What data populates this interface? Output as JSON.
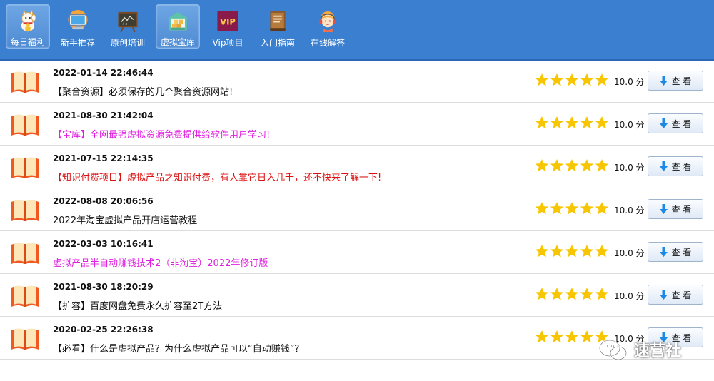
{
  "nav": {
    "items": [
      {
        "label": "每日福利",
        "icon": "lucky-cat-icon",
        "active": true
      },
      {
        "label": "新手推荐",
        "icon": "monitor-icon",
        "active": false
      },
      {
        "label": "原创培训",
        "icon": "chalkboard-icon",
        "active": false
      },
      {
        "label": "虚拟宝库",
        "icon": "warehouse-icon",
        "active": true
      },
      {
        "label": "Vip项目",
        "icon": "vip-icon",
        "active": false
      },
      {
        "label": "入门指南",
        "icon": "book-icon",
        "active": false
      },
      {
        "label": "在线解答",
        "icon": "support-agent-icon",
        "active": false
      }
    ],
    "vip_text": "VIP"
  },
  "colors": {
    "topbar": "#3a7fd0",
    "magenta": "#e020e0",
    "red": "#dd1111",
    "star": "#f7c600"
  },
  "rows": [
    {
      "date": "2022-01-14 22:46:44",
      "title": "【聚合资源】必须保存的几个聚合资源网站!",
      "color": "black",
      "stars": 5,
      "score": "10.0 分",
      "button": "查 看"
    },
    {
      "date": "2021-08-30 21:42:04",
      "title": "【宝库】全网最强虚拟资源免费提供给软件用户学习!",
      "color": "magenta",
      "stars": 5,
      "score": "10.0 分",
      "button": "查 看"
    },
    {
      "date": "2021-07-15 22:14:35",
      "title": "【知识付费项目】虚拟产品之知识付费，有人靠它日入几千，还不快来了解一下!",
      "color": "red",
      "stars": 5,
      "score": "10.0 分",
      "button": "查 看"
    },
    {
      "date": "2022-08-08 20:06:56",
      "title": "2022年淘宝虚拟产品开店运营教程",
      "color": "black",
      "stars": 5,
      "score": "10.0 分",
      "button": "查 看"
    },
    {
      "date": "2022-03-03 10:16:41",
      "title": "虚拟产品半自动赚钱技术2（非淘宝）2022年修订版",
      "color": "magenta",
      "stars": 5,
      "score": "10.0 分",
      "button": "查 看"
    },
    {
      "date": "2021-08-30 18:20:29",
      "title": "【扩容】百度网盘免费永久扩容至2T方法",
      "color": "black",
      "stars": 5,
      "score": "10.0 分",
      "button": "查 看"
    },
    {
      "date": "2020-02-25 22:26:38",
      "title": "【必看】什么是虚拟产品？为什么虚拟产品可以“自动赚钱”？",
      "color": "black",
      "stars": 5,
      "score": "10.0 分",
      "button": "查 看"
    }
  ],
  "watermark": {
    "text": "速营社",
    "icon": "wechat-icon"
  }
}
